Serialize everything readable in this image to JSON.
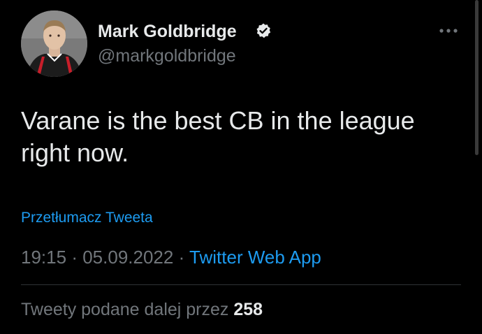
{
  "author": {
    "display_name": "Mark Goldbridge",
    "handle": "@markgoldbridge",
    "verified": true,
    "avatar_icon": "profile-photo"
  },
  "tweet": {
    "text": "Varane is the best CB in the league right now.",
    "translate_label": "Przetłumacz Tweeta",
    "time": "19:15",
    "separator": "·",
    "date": "05.09.2022",
    "source": "Twitter Web App"
  },
  "stats": {
    "retweets_label": "Tweety podane dalej przez",
    "retweets_count": "258"
  },
  "icons": {
    "verified": "verified-badge-icon",
    "more": "more-options-icon"
  },
  "colors": {
    "background": "#000000",
    "primary_text": "#e7e9ea",
    "secondary_text": "#71767b",
    "link": "#1d9bf0"
  }
}
